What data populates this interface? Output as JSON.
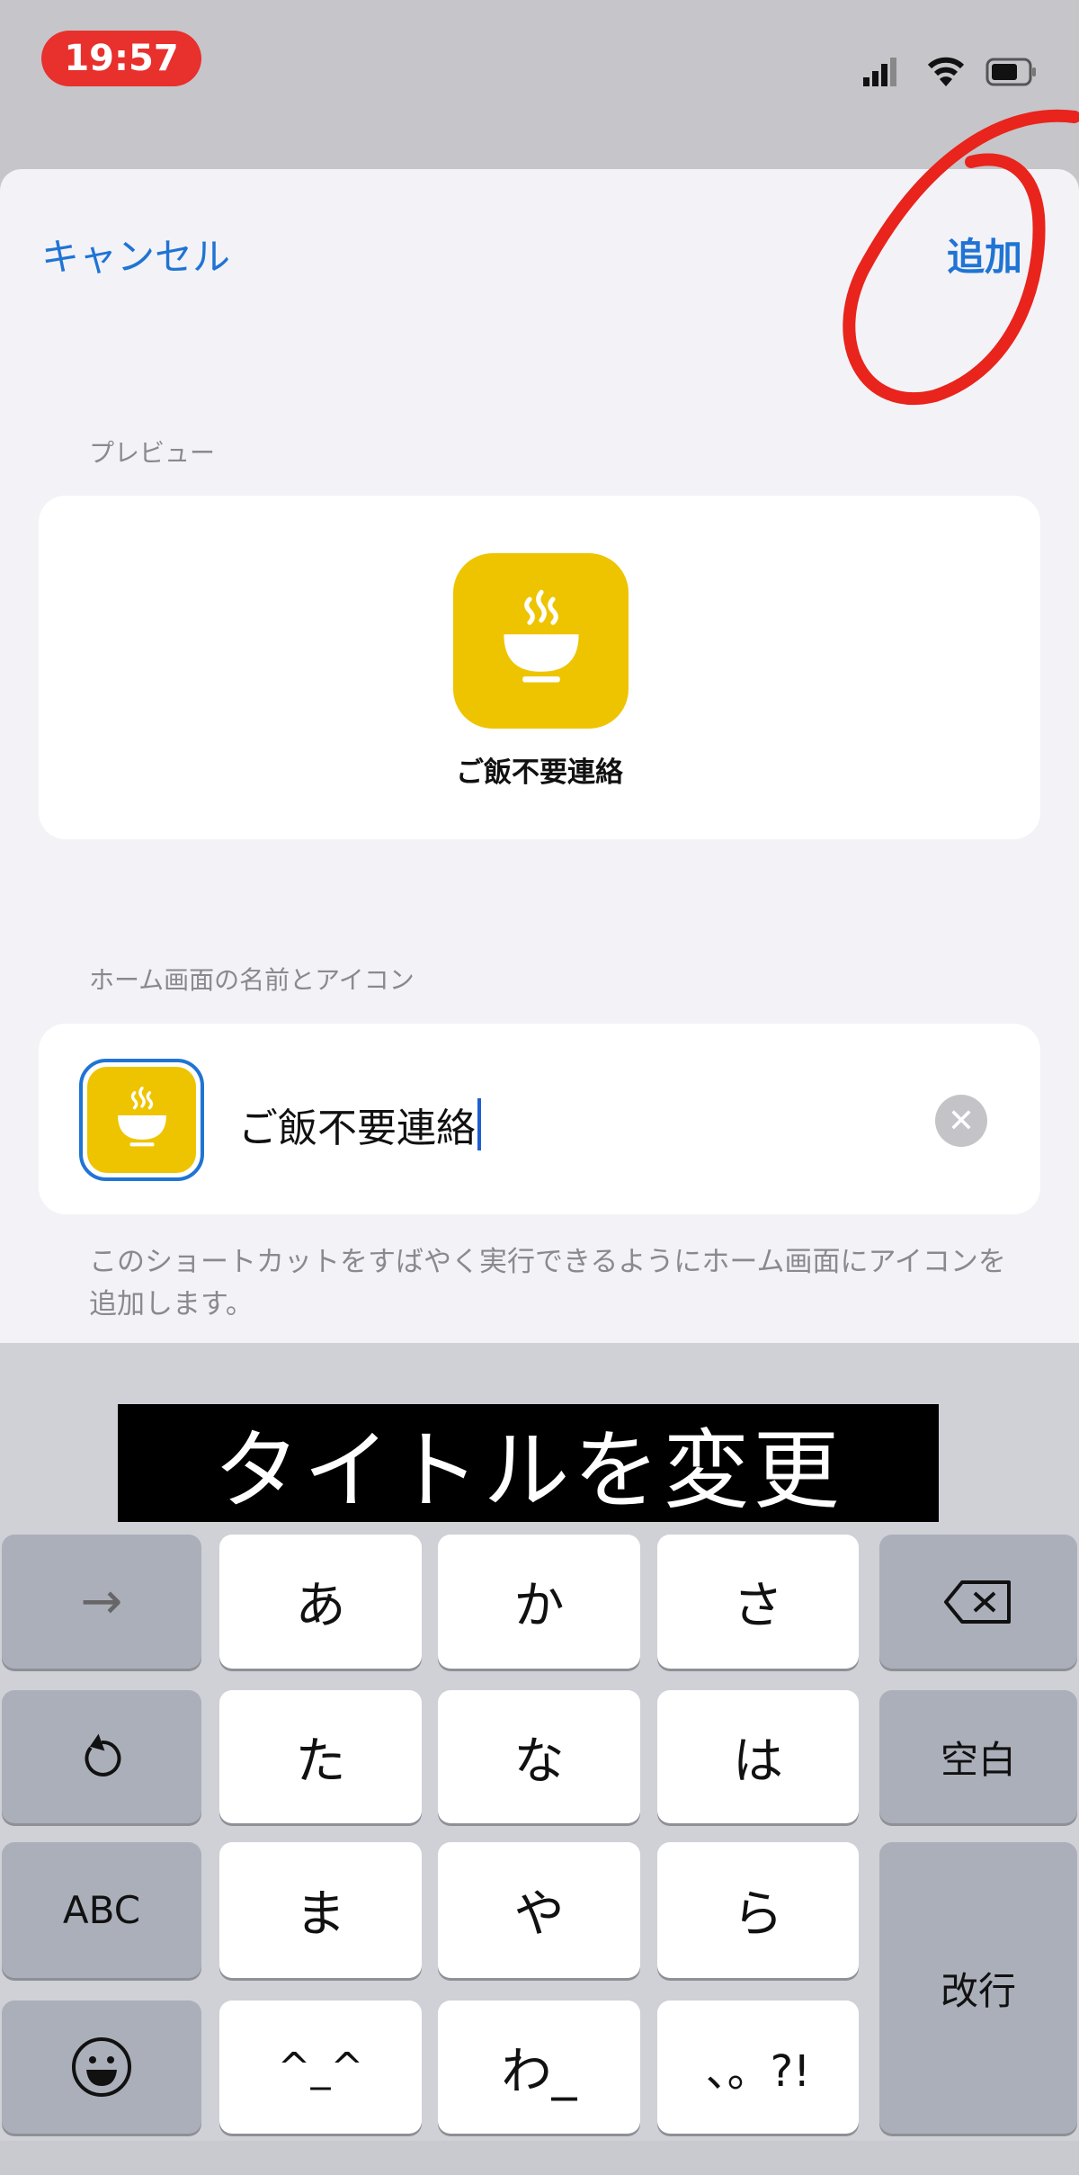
{
  "status_bar": {
    "time": "19:57",
    "icons": [
      "signal-icon",
      "wifi-icon",
      "battery-icon"
    ]
  },
  "nav": {
    "cancel": "キャンセル",
    "add": "追加"
  },
  "preview": {
    "section_label": "プレビュー",
    "app_name": "ご飯不要連絡",
    "icon": "bowl-steam-icon",
    "icon_color": "#eec400"
  },
  "home": {
    "section_label": "ホーム画面の名前とアイコン",
    "name_value": "ご飯不要連絡",
    "footer": "このショートカットをすばやく実行できるようにホーム画面にアイコンを追加します。"
  },
  "caption": "タイトルを変更",
  "annotation_color": "#e8241c",
  "keyboard": {
    "row1": [
      "→",
      "あ",
      "か",
      "さ"
    ],
    "row2": [
      "た",
      "な",
      "は",
      "空白"
    ],
    "row3": [
      "ABC",
      "ま",
      "や",
      "ら",
      "改行"
    ],
    "row4": [
      "^_^",
      "わ_",
      "、。?!"
    ]
  }
}
